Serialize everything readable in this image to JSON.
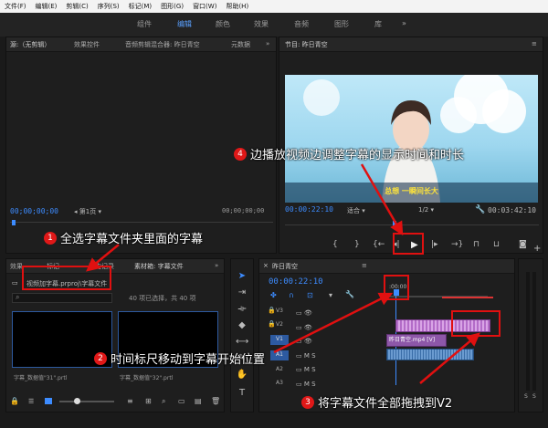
{
  "menu": [
    "文件(F)",
    "编辑(E)",
    "剪辑(C)",
    "序列(S)",
    "标记(M)",
    "图形(G)",
    "窗口(W)",
    "帮助(H)"
  ],
  "workspaces": [
    "组件",
    "编辑",
    "颜色",
    "效果",
    "音频",
    "图形",
    "库"
  ],
  "source": {
    "tabs": [
      "源:（无剪辑）",
      "效果控件",
      "音频剪辑混合器: 昨日青空",
      "元数据"
    ],
    "timecode": "00;00;00;00",
    "page": "第1页",
    "timecode_right": "00;00;00;00"
  },
  "program": {
    "title": "节目: 昨日青空",
    "subtitle": "总想 一瞬间长大",
    "timecode": "00:00:22:10",
    "fit": "适合",
    "ratio": "1/2",
    "duration": "00:03:42:10"
  },
  "project": {
    "tabs": [
      "效果",
      "标记",
      "历史记录",
      "素材箱: 字幕文件"
    ],
    "path": "视频加字幕.prproj\\字幕文件",
    "selection": "40 项已选择，共 40 项",
    "thumbs": [
      "字幕_数据值\"31\".prtl",
      "字幕_数据值\"32\".prtl"
    ]
  },
  "timeline": {
    "title": "昨日青空",
    "timecode": "00:00:22:10",
    "ruler": ":00:00",
    "tracks": [
      "V3",
      "V2",
      "V1",
      "A1",
      "A2",
      "A3"
    ],
    "clip_label": "昨日青空.mp4 [V]"
  },
  "callouts": [
    {
      "num": "1",
      "text": "全选字幕文件夹里面的字幕"
    },
    {
      "num": "2",
      "text": "时间标尺移动到字幕开始位置"
    },
    {
      "num": "3",
      "text": "将字幕文件全部拖拽到V2"
    },
    {
      "num": "4",
      "text": "边播放视频边调整字幕的显示时间和时长"
    }
  ],
  "meter": [
    "S",
    "S"
  ],
  "colors": {
    "accent": "#3d8cff",
    "annotation": "#e01010",
    "clip": "#b36cc8",
    "audio": "#3a6ea8"
  }
}
